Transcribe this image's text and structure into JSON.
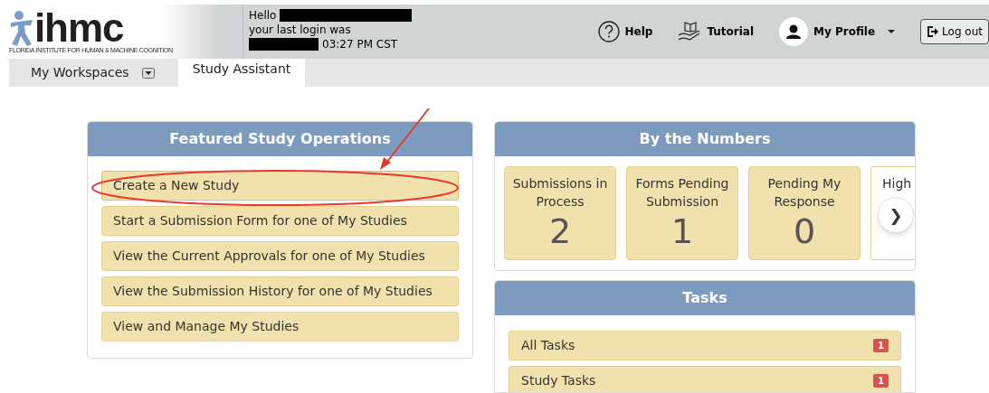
{
  "header": {
    "logo": {
      "wordmark": "ihmc",
      "tagline": "FLORIDA INSTITUTE FOR HUMAN & MACHINE COGNITION"
    },
    "greeting": "Hello",
    "last_login_label": "your last login was",
    "last_login_time": "03:27 PM CST",
    "links": [
      {
        "kind": "help",
        "label": "Help"
      },
      {
        "kind": "tutorial",
        "label": "Tutorial"
      },
      {
        "kind": "profile",
        "label": "My Profile"
      }
    ],
    "logout": "Log out"
  },
  "nav": {
    "workspaces": "My Workspaces",
    "tabs": [
      {
        "label": "Study Assistant",
        "selected": true
      }
    ]
  },
  "featured": {
    "title": "Featured Study Operations",
    "actions": [
      {
        "label": "Create a New Study",
        "highlighted": true
      },
      {
        "label": "Start a Submission Form for one of My Studies",
        "highlighted": false
      },
      {
        "label": "View the Current Approvals for one of My Studies",
        "highlighted": false
      },
      {
        "label": "View the Submission History for one of My Studies",
        "highlighted": false
      },
      {
        "label": "View and Manage My Studies",
        "highlighted": false
      }
    ]
  },
  "numbers": {
    "title": "By the Numbers",
    "cards": [
      {
        "label": "Submissions in Process",
        "value": "2",
        "selected": false
      },
      {
        "label": "Forms Pending Submission",
        "value": "1",
        "selected": false
      },
      {
        "label": "Pending My Response",
        "value": "0",
        "selected": false
      },
      {
        "label": "High",
        "selected": true
      }
    ],
    "next": "❯"
  },
  "tasks": {
    "title": "Tasks",
    "rows": [
      {
        "label": "All Tasks",
        "count": "1"
      },
      {
        "label": "Study Tasks",
        "count": "1"
      }
    ]
  }
}
